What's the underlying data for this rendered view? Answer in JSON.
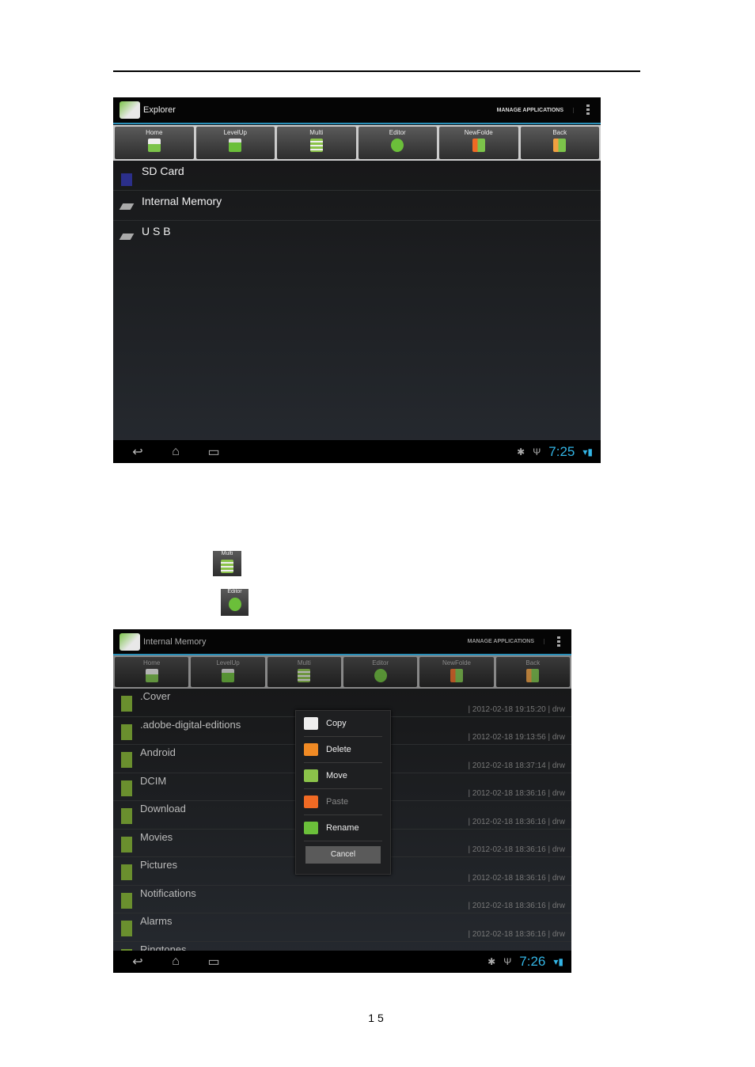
{
  "colors": {
    "accent": "#33b5e5",
    "folder": "#6a8f2e"
  },
  "toolbar": [
    "Home",
    "LevelUp",
    "Multi",
    "Editor",
    "NewFolde",
    "Back"
  ],
  "screen1": {
    "title": "Explorer",
    "manage": "MANAGE APPLICATIONS",
    "items": [
      {
        "label": "SD Card",
        "icon": "sd-card-icon"
      },
      {
        "label": "Internal Memory",
        "icon": "drive-icon"
      },
      {
        "label": "U S B",
        "icon": "drive-icon"
      }
    ],
    "clock": "7:25"
  },
  "inline_icons": {
    "multi": "Multi",
    "editor": "Editor"
  },
  "screen2": {
    "title": "Internal Memory",
    "manage": "MANAGE APPLICATIONS",
    "clock": "7:26",
    "files": [
      {
        "name": ".Cover",
        "meta": "| 2012-02-18 19:15:20 | drw"
      },
      {
        "name": ".adobe-digital-editions",
        "meta": "| 2012-02-18 19:13:56 | drw"
      },
      {
        "name": "Android",
        "meta": "| 2012-02-18 18:37:14 | drw"
      },
      {
        "name": "DCIM",
        "meta": "| 2012-02-18 18:36:16 | drw"
      },
      {
        "name": "Download",
        "meta": "| 2012-02-18 18:36:16 | drw"
      },
      {
        "name": "Movies",
        "meta": "| 2012-02-18 18:36:16 | drw"
      },
      {
        "name": "Pictures",
        "meta": "| 2012-02-18 18:36:16 | drw"
      },
      {
        "name": "Notifications",
        "meta": "| 2012-02-18 18:36:16 | drw"
      },
      {
        "name": "Alarms",
        "meta": "| 2012-02-18 18:36:16 | drw"
      },
      {
        "name": "Ringtones",
        "meta": ""
      }
    ],
    "menu": [
      {
        "label": "Copy",
        "icon": "copy-icon",
        "color": "#eeeeee"
      },
      {
        "label": "Delete",
        "icon": "delete-icon",
        "color": "#f08a24"
      },
      {
        "label": "Move",
        "icon": "move-icon",
        "color": "#8bc34a"
      },
      {
        "label": "Paste",
        "icon": "paste-icon",
        "color": "#f06a24",
        "disabled": true
      },
      {
        "label": "Rename",
        "icon": "rename-icon",
        "color": "#6bbf3a"
      }
    ],
    "cancel": "Cancel"
  },
  "page_number": "15"
}
